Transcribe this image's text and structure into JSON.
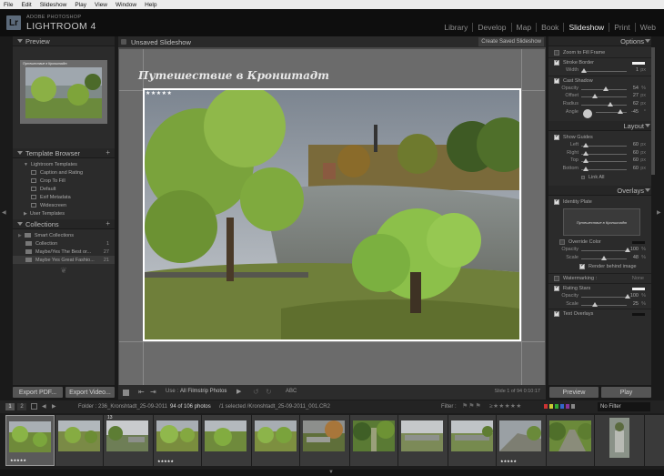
{
  "menubar": [
    "File",
    "Edit",
    "Slideshow",
    "Play",
    "View",
    "Window",
    "Help"
  ],
  "brand": {
    "logo": "Lr",
    "small": "ADOBE PHOTOSHOP",
    "big": "LIGHTROOM 4"
  },
  "modules": [
    {
      "label": "Library",
      "active": false
    },
    {
      "label": "Develop",
      "active": false
    },
    {
      "label": "Map",
      "active": false
    },
    {
      "label": "Book",
      "active": false
    },
    {
      "label": "Slideshow",
      "active": true
    },
    {
      "label": "Print",
      "active": false
    },
    {
      "label": "Web",
      "active": false
    }
  ],
  "left": {
    "preview_title": "Preview",
    "template_browser": {
      "title": "Template Browser",
      "folder": "Lightroom Templates",
      "items": [
        "Caption and Rating",
        "Crop To Fill",
        "Default",
        "Exif Metadata",
        "Widescreen"
      ],
      "user_folder": "User Templates"
    },
    "collections": {
      "title": "Collections",
      "items": [
        {
          "label": "Smart Collections",
          "count": ""
        },
        {
          "label": "Collection",
          "count": "1"
        },
        {
          "label": "Maybe/Yes The Best or...",
          "count": "27"
        },
        {
          "label": "Maybe Yes Great Fashio...",
          "count": "21"
        }
      ]
    },
    "export_pdf": "Export PDF...",
    "export_video": "Export Video..."
  },
  "center": {
    "title": "Unsaved Slideshow",
    "create_saved": "Create Saved Slideshow",
    "slide_title": "Путешествие в Кронштадт",
    "rating": "★★★★★",
    "use_label": "Use :",
    "use_value": "All Filmstrip Photos",
    "abc": "ABC",
    "slide_counter": "Slide 1 of 94  0:10:17"
  },
  "right": {
    "options": {
      "title": "Options",
      "zoom_to_fill": "Zoom to Fill Frame",
      "stroke_border": "Stroke Border",
      "width_label": "Width",
      "width_value": "1",
      "cast_shadow": "Cast Shadow",
      "opacity_label": "Opacity",
      "opacity_value": "54",
      "offset_label": "Offset",
      "offset_value": "27",
      "radius_label": "Radius",
      "radius_value": "62",
      "angle_label": "Angle",
      "angle_value": "-45",
      "unit_px": "px",
      "unit_pct": "%",
      "unit_deg": "°"
    },
    "layout": {
      "title": "Layout",
      "show_guides": "Show Guides",
      "left_label": "Left",
      "left_value": "60",
      "right_label": "Right",
      "right_value": "60",
      "top_label": "Top",
      "top_value": "60",
      "bottom_label": "Bottom",
      "bottom_value": "60",
      "link_all": "Link All"
    },
    "overlays": {
      "title": "Overlays",
      "identity_plate": "Identity Plate",
      "plate_text": "Путешествие в Кронштадт",
      "override_color": "Override Color",
      "opacity_label": "Opacity",
      "opacity_value": "100",
      "scale_label": "Scale",
      "scale_value": "48",
      "render_behind": "Render behind image",
      "watermarking": "Watermarking :",
      "watermark_value": "None",
      "rating_stars": "Rating Stars",
      "rs_opacity_value": "100",
      "rs_scale_value": "25",
      "text_overlays": "Text Overlays"
    },
    "preview_btn": "Preview",
    "play_btn": "Play"
  },
  "filmstrip": {
    "page1": "1",
    "page2": "2",
    "folder": "Folder : 236_Kronshtadt_25-09-2011",
    "count": "94 of 106 photos",
    "selected": "/1 selected /Kronshtadt_25-09-2011_001.CR2",
    "filter_label": "Filter :",
    "no_filter": "No Filter",
    "thumb13_label": "13"
  },
  "colors": {
    "accent": "#e8e8e8",
    "panel": "#2b2b2b",
    "stage": "#6b6b6b"
  }
}
